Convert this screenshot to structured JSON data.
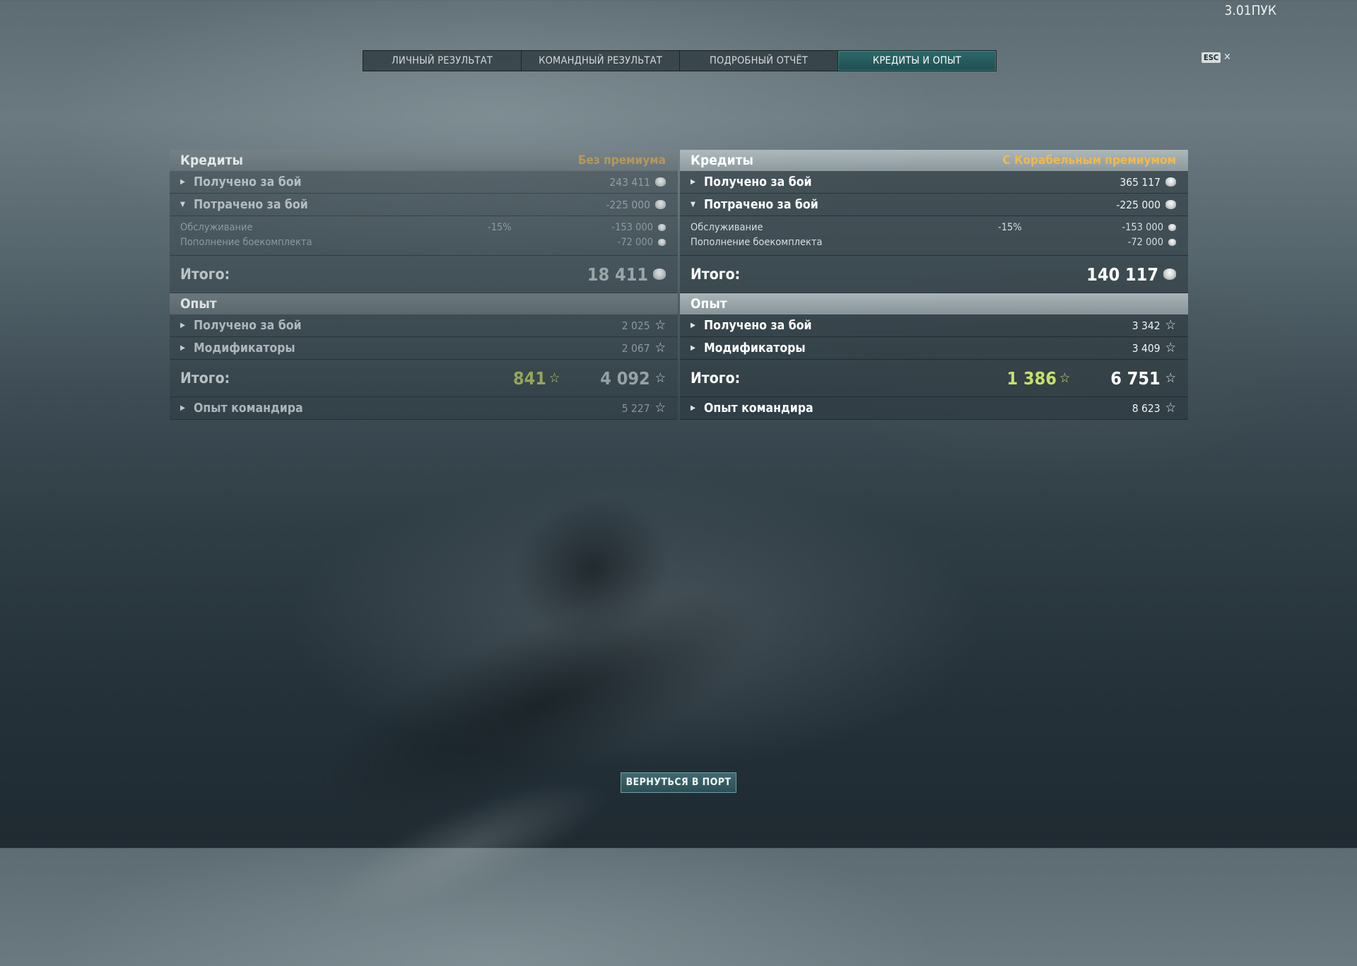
{
  "currency_display": "3.01ПУК",
  "tabs": [
    {
      "label": "ЛИЧНЫЙ РЕЗУЛЬТАТ",
      "active": false
    },
    {
      "label": "КОМАНДНЫЙ РЕЗУЛЬТАТ",
      "active": false
    },
    {
      "label": "ПОДРОБНЫЙ ОТЧЁТ",
      "active": false
    },
    {
      "label": "КРЕДИТЫ И ОПЫТ",
      "active": true
    }
  ],
  "esc": {
    "key": "ESC",
    "close": "✕"
  },
  "panels": {
    "left": {
      "credits_header": "Кредиты",
      "credits_subtitle": "Без премиума",
      "earned_label": "Получено за бой",
      "earned_value": "243 411",
      "spent_label": "Потрачено за бой",
      "spent_value": "-225 000",
      "service_label": "Обслуживание",
      "service_pct": "-15%",
      "service_value": "-153 000",
      "ammo_label": "Пополнение боекомплекта",
      "ammo_value": "-72 000",
      "credits_total_label": "Итого:",
      "credits_total_value": "18 411",
      "exp_header": "Опыт",
      "exp_earned_label": "Получено за бой",
      "exp_earned_value": "2 025",
      "modifiers_label": "Модификаторы",
      "modifiers_value": "2 067",
      "exp_total_label": "Итого:",
      "exp_total_bonus": "841",
      "exp_total_value": "4 092",
      "commander_label": "Опыт командира",
      "commander_value": "5 227"
    },
    "right": {
      "credits_header": "Кредиты",
      "credits_subtitle": "С Корабельным премиумом",
      "earned_label": "Получено за бой",
      "earned_value": "365 117",
      "spent_label": "Потрачено за бой",
      "spent_value": "-225 000",
      "service_label": "Обслуживание",
      "service_pct": "-15%",
      "service_value": "-153 000",
      "ammo_label": "Пополнение боекомплекта",
      "ammo_value": "-72 000",
      "credits_total_label": "Итого:",
      "credits_total_value": "140 117",
      "exp_header": "Опыт",
      "exp_earned_label": "Получено за бой",
      "exp_earned_value": "3 342",
      "modifiers_label": "Модификаторы",
      "modifiers_value": "3 409",
      "exp_total_label": "Итого:",
      "exp_total_bonus": "1 386",
      "exp_total_value": "6 751",
      "commander_label": "Опыт командира",
      "commander_value": "8 623"
    }
  },
  "icons": {
    "collapsed": "▶",
    "expanded": "▼",
    "star": "☆",
    "credits": "credit-coin-icon"
  },
  "colors": {
    "accent_tab": "#2c6a6a",
    "premium_label": "#f2b84a",
    "bonus_exp": "#c7e06a"
  },
  "back_button": "ВЕРНУТЬСЯ В ПОРТ"
}
